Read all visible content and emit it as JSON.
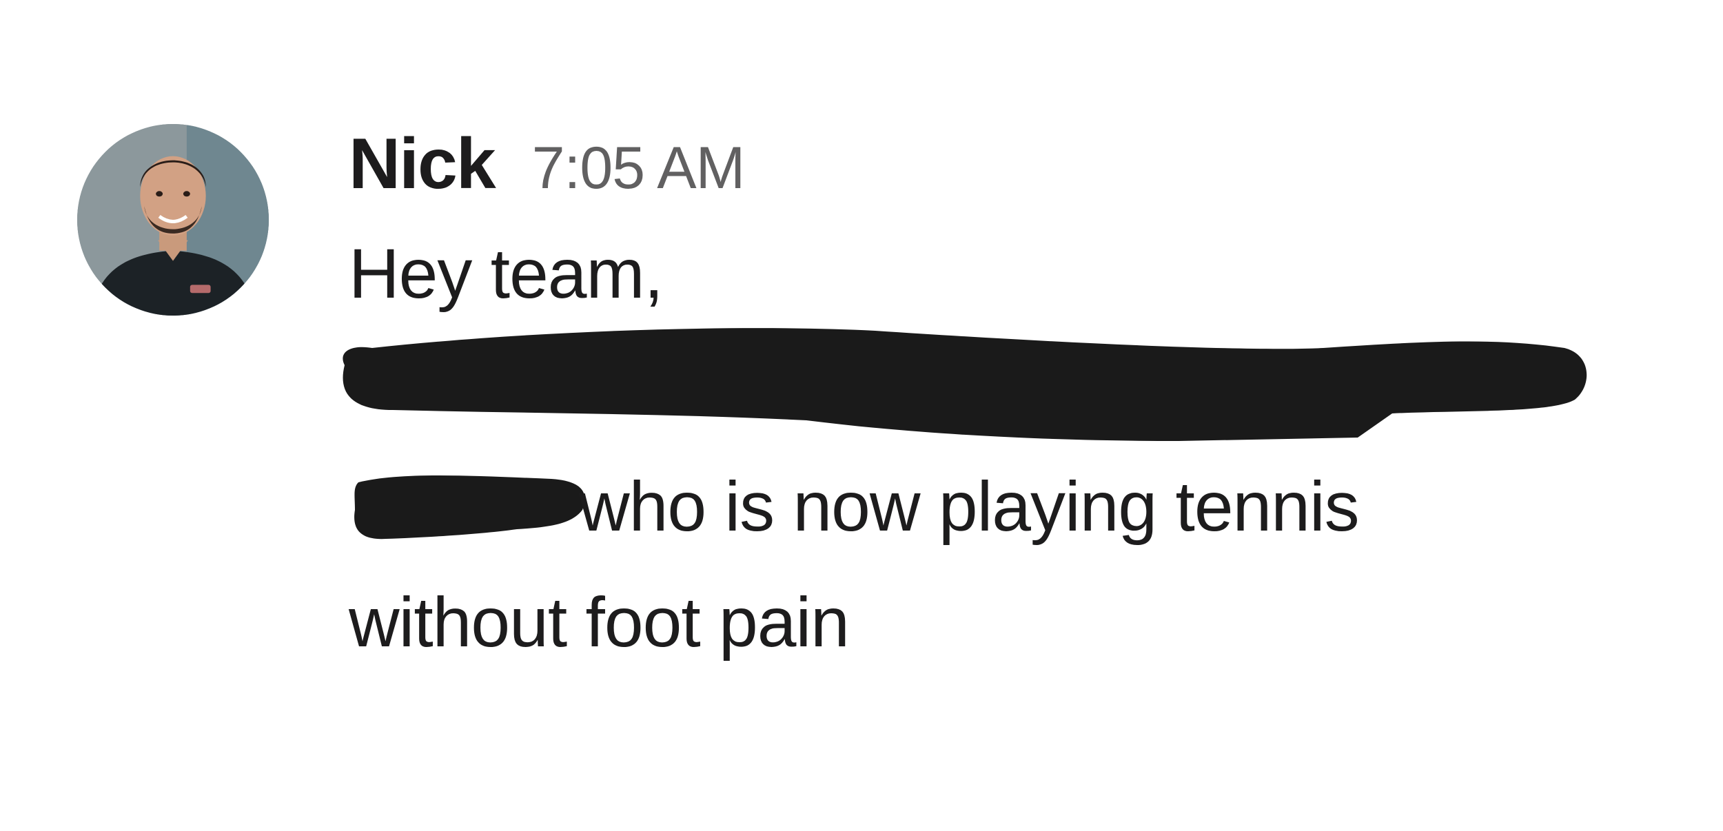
{
  "message": {
    "sender": "Nick",
    "timestamp": "7:05 AM",
    "avatar_icon": "profile-photo",
    "lines": [
      "Hey team,",
      "who is now playing tennis",
      "without foot pain"
    ],
    "redaction_color": "#1a1a1a"
  }
}
